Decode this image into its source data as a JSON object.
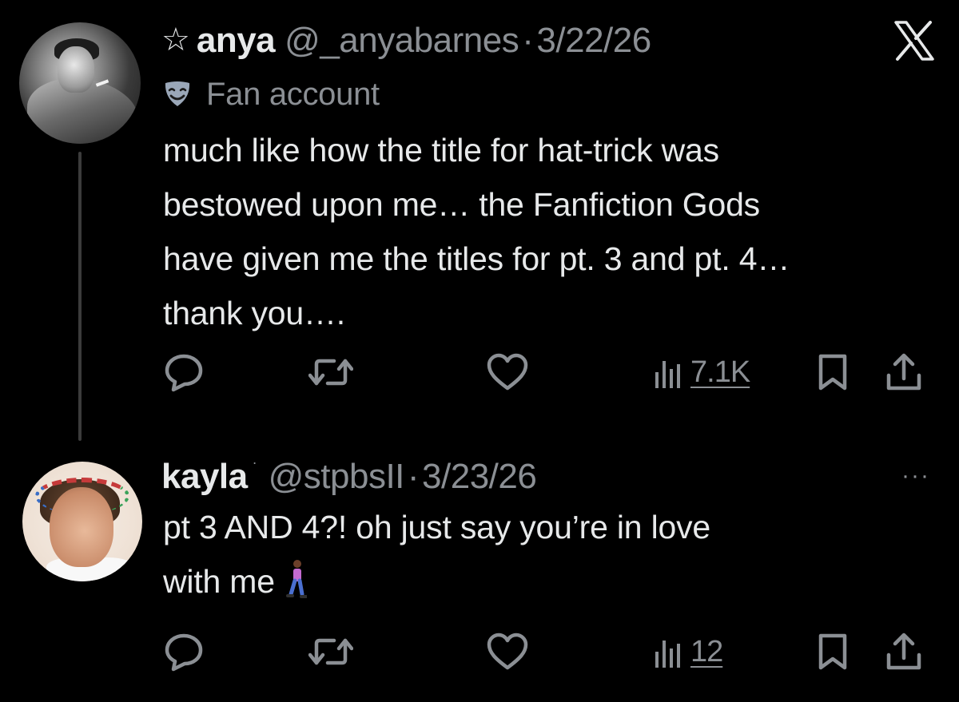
{
  "tweets": [
    {
      "display_name": "anya",
      "handle": "@_anyabarnes",
      "separator": "·",
      "date": "3/22/26",
      "label": "Fan account",
      "text_lines": [
        "much like how the title for hat-trick was",
        "bestowed upon me… the Fanfiction Gods",
        "have given me the titles for pt. 3 and pt. 4…",
        "thank you…."
      ],
      "views": "7.1K"
    },
    {
      "display_name": "kayla",
      "name_dot": "·",
      "handle": "@stpbsII",
      "separator": "·",
      "date": "3/23/26",
      "text_lines": [
        "pt 3 AND 4?! oh just say you’re in love",
        "with me"
      ],
      "views": "12"
    }
  ],
  "icons": {
    "star": "☆",
    "more": "···"
  },
  "colors": {
    "background": "#000000",
    "primary_text": "#e7e9ea",
    "secondary_text": "#8b8f94",
    "thread_line": "#3c3c3c"
  }
}
